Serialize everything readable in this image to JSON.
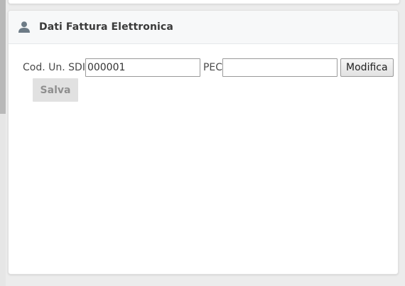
{
  "panel": {
    "title": "Dati Fattura Elettronica",
    "icon": "user-icon"
  },
  "form": {
    "sdi_label": "Cod. Un. SDI",
    "sdi_value": "000001",
    "pec_label": "PEC",
    "pec_value": "",
    "modify_label": "Modifica",
    "save_label": "Salva"
  },
  "colors": {
    "background": "#ececec",
    "header_bg": "#f7f8f9",
    "icon": "#6d7b86",
    "save_disabled_bg": "#e1e1e1",
    "save_disabled_text": "#8f8f8f"
  }
}
